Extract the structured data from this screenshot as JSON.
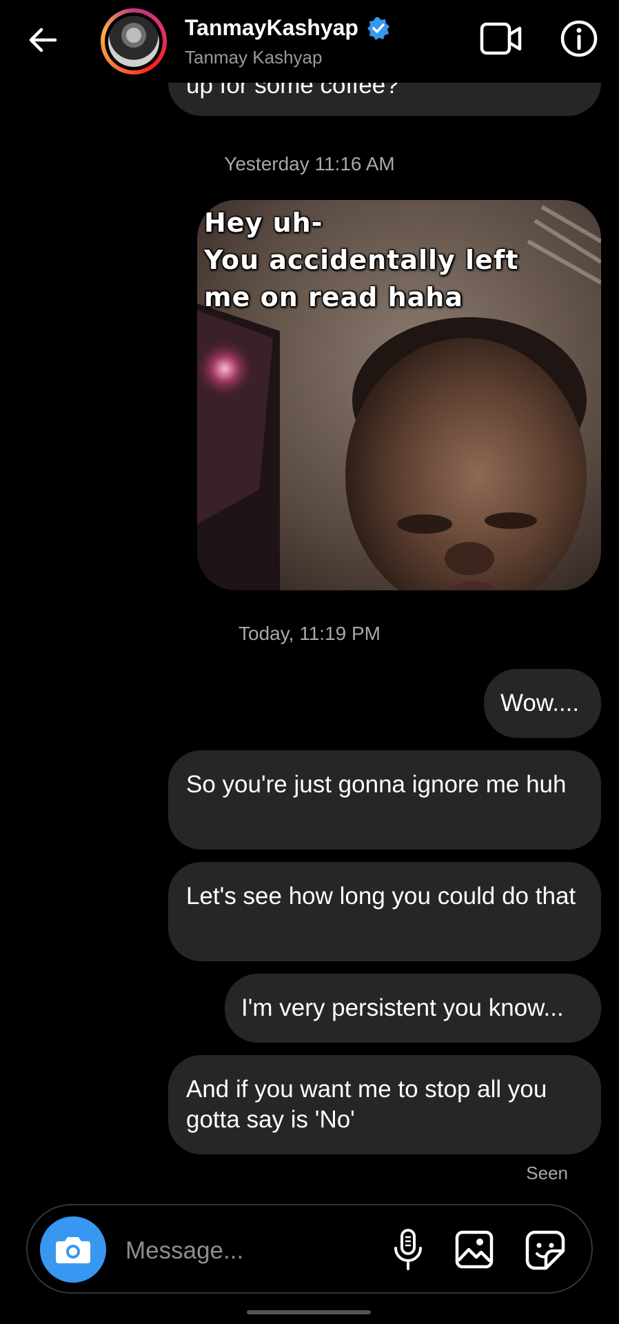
{
  "header": {
    "username": "TanmayKashyap",
    "subname": "Tanmay Kashyap",
    "back_icon": "arrow-left-icon",
    "verified_icon": "verified-badge-icon",
    "video_icon": "video-camera-icon",
    "info_icon": "info-icon"
  },
  "colors": {
    "background": "#000000",
    "bubble": "#262626",
    "accent": "#3897f0",
    "verified": "#3897f0",
    "muted_text": "#a8a8a8"
  },
  "messages": {
    "partial_top": "up for some coffee?",
    "timestamp_1": "Yesterday 11:16 AM",
    "meme": {
      "line1": "Hey uh-",
      "line2": "You accidentally left",
      "line3": "me on read haha"
    },
    "timestamp_2": "Today, 11:19 PM",
    "m1": "Wow....",
    "m2": "So you're just gonna ignore me huh",
    "m3": "Let's see how long you could do that",
    "m4": "I'm very persistent you know...",
    "m5": "And if you want me to stop all you gotta say is 'No'",
    "seen": "Seen"
  },
  "composer": {
    "placeholder": "Message...",
    "camera_icon": "camera-icon",
    "mic_icon": "microphone-icon",
    "gallery_icon": "image-gallery-icon",
    "sticker_icon": "sticker-icon"
  }
}
